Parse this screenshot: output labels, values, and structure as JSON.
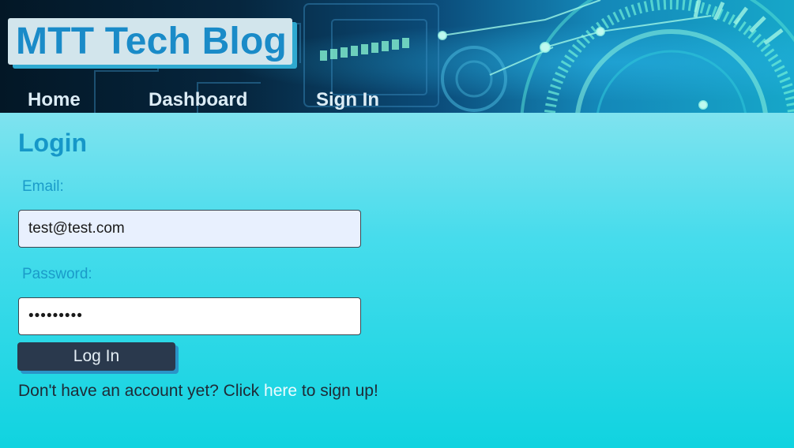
{
  "header": {
    "site_title": "MTT Tech Blog",
    "nav": [
      {
        "label": "Home"
      },
      {
        "label": "Dashboard"
      },
      {
        "label": "Sign In"
      }
    ]
  },
  "login": {
    "title": "Login",
    "email_label": "Email:",
    "email_value": "test@test.com",
    "password_label": "Password:",
    "password_value": "testtest1",
    "submit_label": "Log In",
    "signup_prefix": "Don't have an account yet? Click ",
    "signup_link": "here",
    "signup_suffix": " to sign up!"
  },
  "colors": {
    "accent": "#1a8bc8",
    "button_bg": "#2a394d",
    "link": "#ecfbff",
    "page_bg_top": "#7fe3ef",
    "page_bg_bottom": "#10d3e0"
  }
}
